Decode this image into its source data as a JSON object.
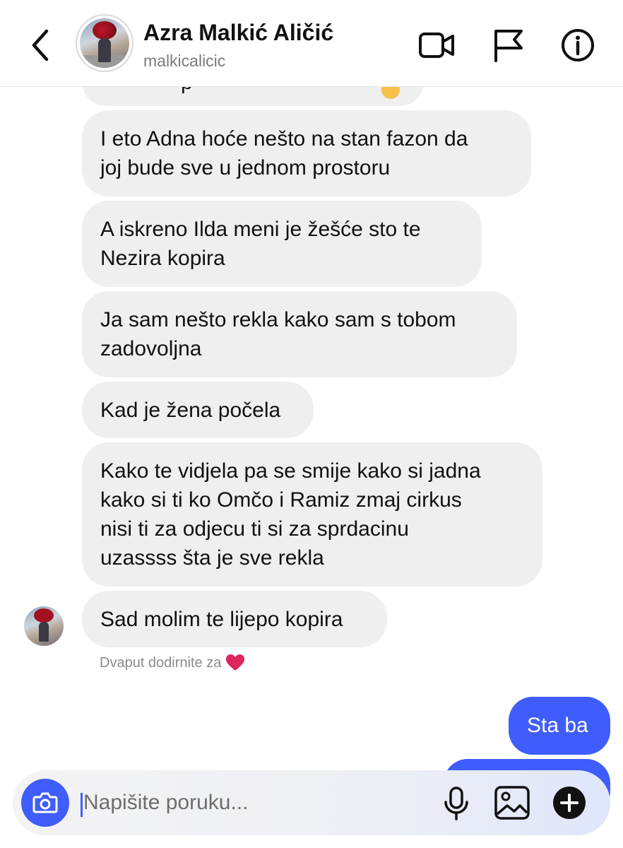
{
  "header": {
    "contact_name": "Azra Malkić Aličić",
    "contact_handle": "malkicalicic",
    "icons": [
      "chevron-left-icon",
      "video-camera-icon",
      "flag-icon",
      "info-icon"
    ]
  },
  "messages": [
    {
      "sender": "contact",
      "text": "I eto Adna hoće nešto na stan fazon da\njoj bude sve u jednom prostoru"
    },
    {
      "sender": "contact",
      "text": "A iskreno Ilda meni je žešće sto te\nNezira kopira"
    },
    {
      "sender": "contact",
      "text": "Ja sam nešto rekla kako sam s tobom\nzadovoljna"
    },
    {
      "sender": "contact",
      "text": "Kad je žena počela"
    },
    {
      "sender": "contact",
      "text": "Kako te vidjela pa se smije kako si jadna\nkako si ti ko Omčo i Ramiz zmaj cirkus\nnisi ti za odjecu ti si za sprdacinu\nuzassss šta je sve rekla"
    },
    {
      "sender": "contact",
      "text": "Sad molim te lijepo kopira"
    },
    {
      "sender": "me",
      "text": "Sta ba"
    }
  ],
  "partial_top_message": {
    "visible_char": "p"
  },
  "double_tap_hint": "Dvaput dodirnite za",
  "composer": {
    "placeholder": "Napišite poruku...",
    "value": ""
  },
  "colors": {
    "accent": "#3f5dfc",
    "incoming_bubble": "#efefef",
    "heart": "#e0245e"
  }
}
